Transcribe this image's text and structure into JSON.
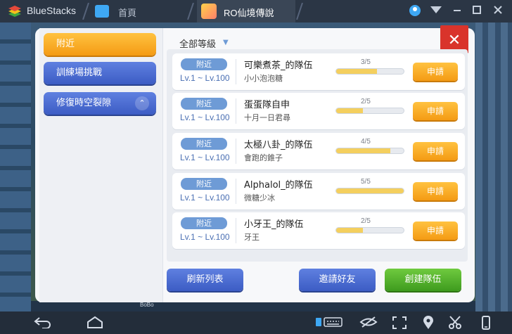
{
  "titlebar": {
    "app_name": "BlueStacks",
    "tab_home_label": "首頁",
    "tab_game_label": "RO仙境傳說",
    "controls": [
      "user-icon",
      "wifi-icon",
      "minimize-icon",
      "maximize-icon",
      "close-icon"
    ]
  },
  "background": {
    "label": "BoBo"
  },
  "panel": {
    "close_symbol": "✕",
    "menu": [
      {
        "label": "附近",
        "active": true
      },
      {
        "label": "訓練場挑戰",
        "active": false
      },
      {
        "label": "修復時空裂隙",
        "active": false,
        "expand_symbol": "⌃"
      }
    ],
    "filter": {
      "label": "全部等級",
      "caret": "▼"
    },
    "rows": [
      {
        "badge": "附近",
        "level": "Lv.1 ~ Lv.100",
        "name": "可樂煮茶_的隊伍",
        "leader": "小小泡泡糖",
        "count": "3/5",
        "fill": 0.6,
        "apply": "申請"
      },
      {
        "badge": "附近",
        "level": "Lv.1 ~ Lv.100",
        "name": "蛋蛋隊自申",
        "leader": "十月一日君尋",
        "count": "2/5",
        "fill": 0.4,
        "apply": "申請"
      },
      {
        "badge": "附近",
        "level": "Lv.1 ~ Lv.100",
        "name": "太極八卦_的隊伍",
        "leader": "會跑的錐子",
        "count": "4/5",
        "fill": 0.8,
        "apply": "申請"
      },
      {
        "badge": "附近",
        "level": "Lv.1 ~ Lv.100",
        "name": "Alphalol_的隊伍",
        "leader": "微糖少冰",
        "count": "5/5",
        "fill": 1.0,
        "apply": "申請"
      },
      {
        "badge": "附近",
        "level": "Lv.1 ~ Lv.100",
        "name": "小牙王_的隊伍",
        "leader": "牙王",
        "count": "2/5",
        "fill": 0.4,
        "apply": "申請"
      }
    ],
    "buttons": {
      "refresh": "刷新列表",
      "invite": "邀請好友",
      "create": "創建隊伍"
    }
  },
  "navbar": {
    "icons": [
      "back-icon",
      "home-icon",
      "keyboard-icon",
      "eye-icon",
      "fullscreen-icon",
      "location-icon",
      "scissors-icon",
      "phone-rotate-icon"
    ]
  },
  "colors": {
    "orange": "#f49b14",
    "blue": "#3c5cc4",
    "green": "#3e9b1e",
    "close_red": "#d9342b"
  }
}
